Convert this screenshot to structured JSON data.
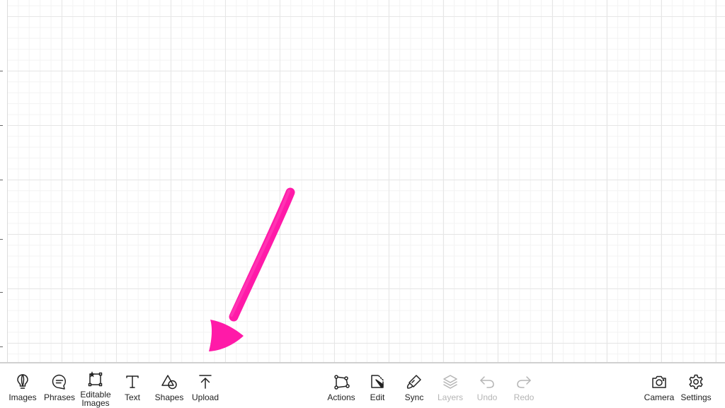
{
  "colors": {
    "accent_arrow": "#ff1aa8",
    "icon": "#222222",
    "disabled": "#b5b5b5"
  },
  "toolbar": {
    "left_tools": [
      {
        "label": "Images",
        "icon": "lightbulb-icon"
      },
      {
        "label": "Phrases",
        "icon": "speech-bubble-icon"
      },
      {
        "label": "Editable Images",
        "icon": "editable-image-icon"
      },
      {
        "label": "Text",
        "icon": "text-icon"
      },
      {
        "label": "Shapes",
        "icon": "shapes-icon"
      },
      {
        "label": "Upload",
        "icon": "upload-icon"
      }
    ],
    "center_tools": [
      {
        "label": "Actions",
        "icon": "actions-icon",
        "enabled": true
      },
      {
        "label": "Edit",
        "icon": "edit-icon",
        "enabled": true
      },
      {
        "label": "Sync",
        "icon": "sync-icon",
        "enabled": true
      },
      {
        "label": "Layers",
        "icon": "layers-icon",
        "enabled": false
      },
      {
        "label": "Undo",
        "icon": "undo-icon",
        "enabled": false
      },
      {
        "label": "Redo",
        "icon": "redo-icon",
        "enabled": false
      }
    ],
    "right_tools": [
      {
        "label": "Camera",
        "icon": "camera-icon"
      },
      {
        "label": "Settings",
        "icon": "gear-icon"
      }
    ]
  }
}
